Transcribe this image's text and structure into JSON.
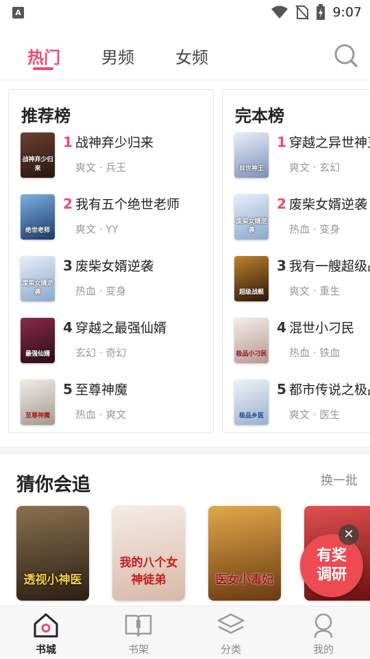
{
  "status_bar": {
    "app_icon": "A",
    "time": "9:07"
  },
  "top_tabs": [
    {
      "label": "热门",
      "active": true
    },
    {
      "label": "男频",
      "active": false
    },
    {
      "label": "女频",
      "active": false
    }
  ],
  "rank_panels": [
    {
      "title": "推荐榜",
      "items": [
        {
          "rank": "1",
          "name": "战神弃少归来",
          "tags": "爽文 · 兵王",
          "cover_text": "战神弃少归来",
          "cover_color": "#3a2018"
        },
        {
          "rank": "2",
          "name": "我有五个绝世老师",
          "tags": "爽文 · YY",
          "cover_text": "绝世老师",
          "cover_color": "#2e5a8c"
        },
        {
          "rank": "3",
          "name": "废柴女婿逆袭",
          "tags": "热血 · 变身",
          "cover_text": "废柴女婿逆袭",
          "cover_color": "#9cb6d6"
        },
        {
          "rank": "4",
          "name": "穿越之最强仙婿",
          "tags": "玄幻 · 奇幻",
          "cover_text": "最强仙婿",
          "cover_color": "#5a1a2a"
        },
        {
          "rank": "5",
          "name": "至尊神魔",
          "tags": "热血 · 爽文",
          "cover_text": "至尊神魔",
          "cover_color": "#c9c2b8"
        }
      ]
    },
    {
      "title": "完本榜",
      "items": [
        {
          "rank": "1",
          "name": "穿越之异世神王",
          "tags": "爽文 · 玄幻",
          "cover_text": "异世神王",
          "cover_color": "#b8c6de"
        },
        {
          "rank": "2",
          "name": "废柴女婿逆袭",
          "tags": "热血 · 变身",
          "cover_text": "废柴女婿逆袭",
          "cover_color": "#9cb6d6"
        },
        {
          "rank": "3",
          "name": "我有一艘超级战舰",
          "tags": "爽文 · 重生",
          "cover_text": "超级战舰",
          "cover_color": "#3a2a10"
        },
        {
          "rank": "4",
          "name": "混世小刁民",
          "tags": "热血 · 铁血",
          "cover_text": "极品小刁民",
          "cover_color": "#d8c8c0"
        },
        {
          "rank": "5",
          "name": "都市传说之极品神医",
          "tags": "爽文 · 医生",
          "cover_text": "极品乡医",
          "cover_color": "#d0dcea"
        }
      ]
    }
  ],
  "guess_section": {
    "title": "猜你会追",
    "refresh": "换一批",
    "covers": [
      {
        "text": "透视小神医",
        "color": "#4a3a26"
      },
      {
        "text": "我的八个女神徒弟",
        "color": "#e8d4c4"
      },
      {
        "text": "医女小毒妃",
        "color": "#c08a3a"
      },
      {
        "text": "",
        "color": "#b02a2a"
      }
    ]
  },
  "float_ad": {
    "line1": "有奖",
    "line2": "调研",
    "close": "✕"
  },
  "bottom_nav": [
    {
      "label": "书城",
      "icon": "home-icon",
      "active": true
    },
    {
      "label": "书架",
      "icon": "bookshelf-icon",
      "active": false
    },
    {
      "label": "分类",
      "icon": "category-icon",
      "active": false
    },
    {
      "label": "我的",
      "icon": "profile-icon",
      "active": false
    }
  ],
  "colors": {
    "accent": "#ef4b70",
    "ad": "#ee4a52"
  }
}
